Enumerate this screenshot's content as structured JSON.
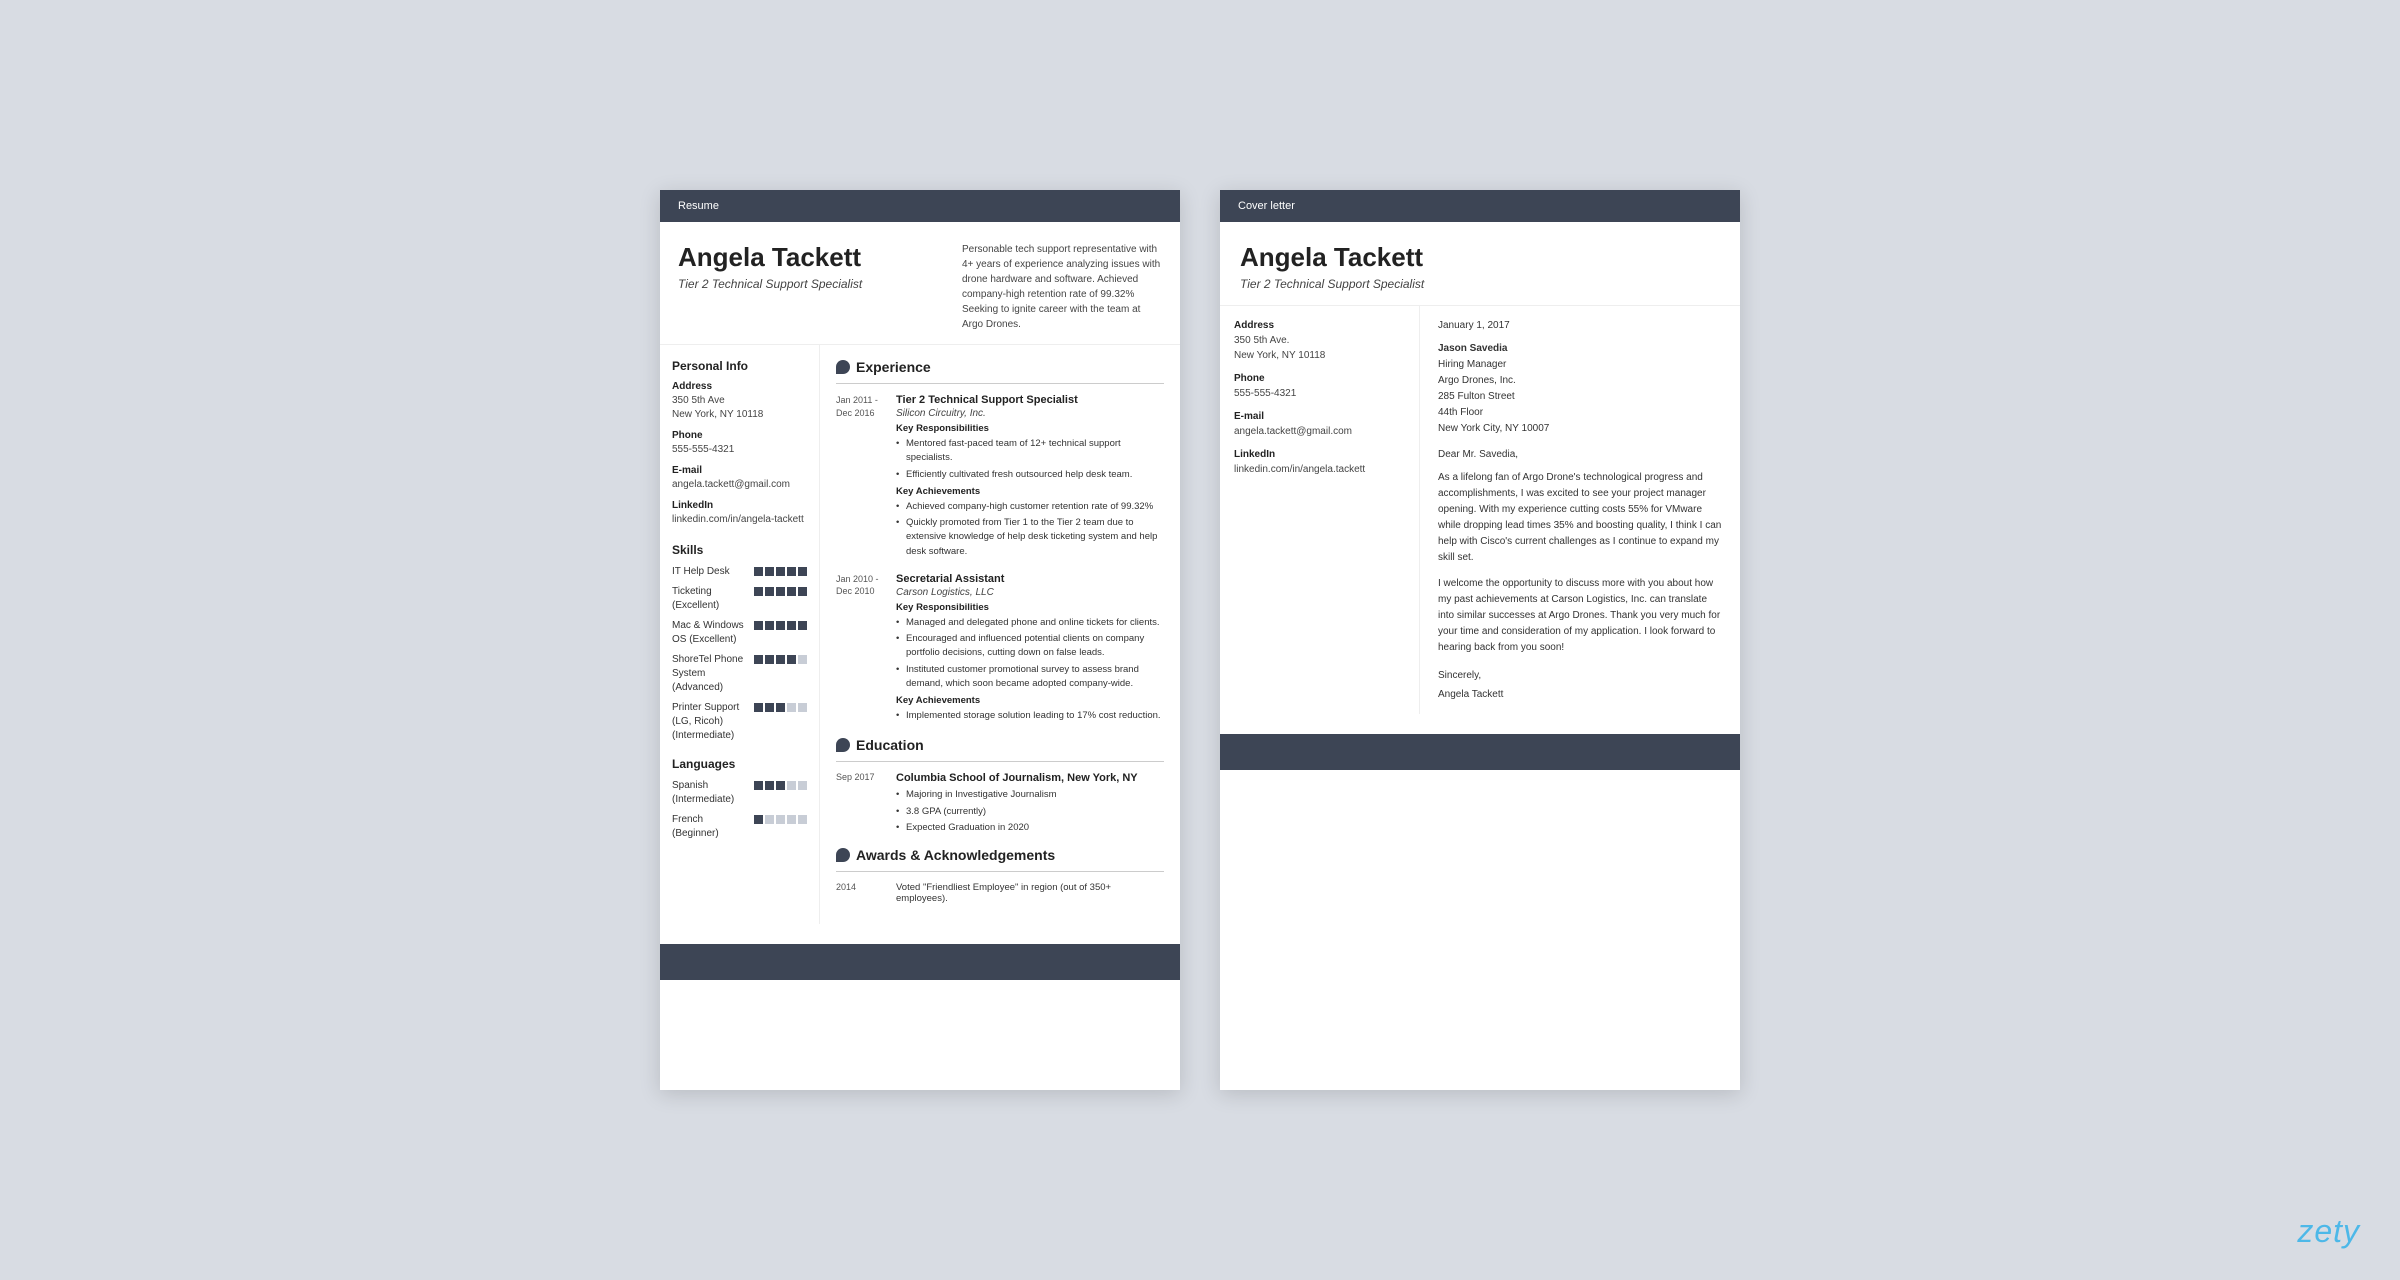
{
  "resume": {
    "header_label": "Resume",
    "name": "Angela Tackett",
    "title": "Tier 2 Technical Support Specialist",
    "summary": "Personable tech support representative with 4+ years of experience analyzing issues with drone hardware and software. Achieved company-high retention rate of 99.32% Seeking to ignite career with the team at Argo Drones.",
    "personal_info": {
      "section_title": "Personal Info",
      "address_label": "Address",
      "address_line1": "350 5th Ave",
      "address_line2": "New York, NY 10118",
      "phone_label": "Phone",
      "phone": "555-555-4321",
      "email_label": "E-mail",
      "email": "angela.tackett@gmail.com",
      "linkedin_label": "LinkedIn",
      "linkedin": "linkedin.com/in/angela-tackett"
    },
    "skills": {
      "section_title": "Skills",
      "items": [
        {
          "name": "IT Help Desk",
          "level": 5,
          "note": ""
        },
        {
          "name": "Ticketing\n(Excellent)",
          "level": 5,
          "note": ""
        },
        {
          "name": "Mac & Windows\nOS (Excellent)",
          "level": 5,
          "note": ""
        },
        {
          "name": "ShoreTel Phone\nSystem\n(Advanced)",
          "level": 4,
          "note": ""
        },
        {
          "name": "Printer Support\n(LG, Ricoh)\n(Intermediate)",
          "level": 3,
          "note": ""
        }
      ]
    },
    "languages": {
      "section_title": "Languages",
      "items": [
        {
          "name": "Spanish\n(Intermediate)",
          "level": 3
        },
        {
          "name": "French\n(Beginner)",
          "level": 1
        }
      ]
    },
    "experience": {
      "section_title": "Experience",
      "items": [
        {
          "date_from": "Jan 2011 -",
          "date_to": "Dec 2016",
          "job_title": "Tier 2 Technical Support Specialist",
          "company": "Silicon Circuitry, Inc.",
          "responsibilities_label": "Key Responsibilities",
          "responsibilities": [
            "Mentored fast-paced team of 12+ technical support specialists.",
            "Efficiently cultivated fresh outsourced help desk team."
          ],
          "achievements_label": "Key Achievements",
          "achievements": [
            "Achieved company-high customer retention rate of 99.32%",
            "Quickly promoted from Tier 1 to the Tier 2 team due to extensive knowledge of help desk ticketing system and help desk software."
          ]
        },
        {
          "date_from": "Jan 2010 -",
          "date_to": "Dec 2010",
          "job_title": "Secretarial Assistant",
          "company": "Carson Logistics, LLC",
          "responsibilities_label": "Key Responsibilities",
          "responsibilities": [
            "Managed and delegated phone and online tickets for clients.",
            "Encouraged and influenced potential clients on company portfolio decisions, cutting down on false leads.",
            "Instituted customer promotional survey to assess brand demand, which soon became adopted company-wide."
          ],
          "achievements_label": "Key Achievements",
          "achievements": [
            "Implemented storage solution leading to 17% cost reduction."
          ]
        }
      ]
    },
    "education": {
      "section_title": "Education",
      "items": [
        {
          "date": "Sep 2017",
          "school": "Columbia School of Journalism, New York, NY",
          "bullets": [
            "Majoring in Investigative Journalism",
            "3.8 GPA (currently)",
            "Expected Graduation in 2020"
          ]
        }
      ]
    },
    "awards": {
      "section_title": "Awards & Acknowledgements",
      "items": [
        {
          "year": "2014",
          "text": "Voted \"Friendliest Employee\" in region (out of 350+ employees)."
        }
      ]
    }
  },
  "cover_letter": {
    "header_label": "Cover letter",
    "name": "Angela Tackett",
    "title": "Tier 2 Technical Support Specialist",
    "personal_info": {
      "address_label": "Address",
      "address_line1": "350 5th Ave.",
      "address_line2": "New York, NY 10118",
      "phone_label": "Phone",
      "phone": "555-555-4321",
      "email_label": "E-mail",
      "email": "angela.tackett@gmail.com",
      "linkedin_label": "LinkedIn",
      "linkedin": "linkedin.com/in/angela.tackett"
    },
    "date": "January 1, 2017",
    "recipient_name": "Jason Savedia",
    "recipient_title": "Hiring Manager",
    "recipient_company": "Argo Drones, Inc.",
    "recipient_address1": "285 Fulton Street",
    "recipient_address2": "44th Floor",
    "recipient_address3": "New York City, NY 10007",
    "greeting": "Dear Mr. Savedia,",
    "paragraph1": "As a lifelong fan of Argo Drone's technological progress and accomplishments, I was excited to see your project manager opening. With my experience cutting costs 55% for VMware while dropping lead times 35% and boosting quality, I think I can help with Cisco's current challenges as I continue to expand my skill set.",
    "paragraph2": "I welcome the opportunity to discuss more with you about how my past achievements at Carson Logistics, Inc. can translate into similar successes at Argo Drones. Thank you very much for your time and consideration of my application. I look forward to hearing back from you soon!",
    "closing": "Sincerely,",
    "signoff": "Angela Tackett"
  },
  "branding": {
    "zety_logo": "zety"
  }
}
